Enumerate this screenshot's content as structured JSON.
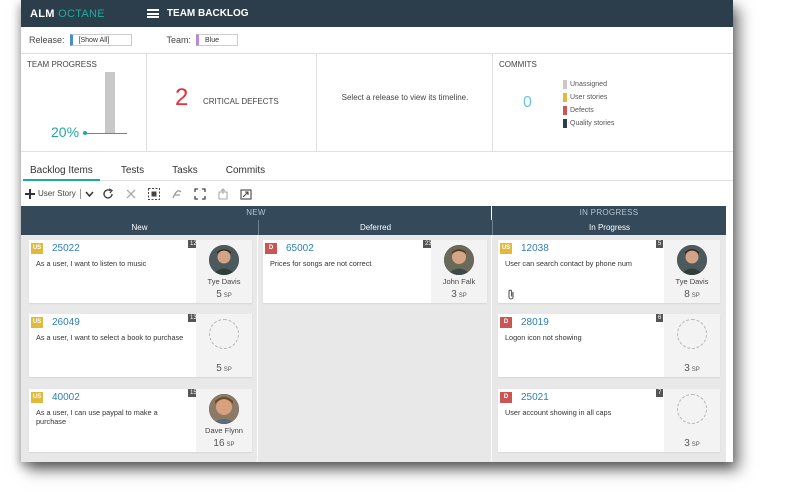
{
  "app": {
    "logo_bold": "ALM",
    "logo_light": "OCTANE",
    "page_title": "TEAM BACKLOG"
  },
  "filters": {
    "release_label": "Release:",
    "release_value": "[Show All]",
    "team_label": "Team:",
    "team_value": "Blue"
  },
  "widgets": {
    "progress": {
      "title": "TEAM PROGRESS",
      "percent_text": "20%",
      "percent_value": 0.2
    },
    "defects": {
      "count": "2",
      "label": "CRITICAL DEFECTS"
    },
    "timeline": {
      "message": "Select a release to view its timeline."
    },
    "commits": {
      "title": "COMMITS",
      "count": "0",
      "legend": [
        {
          "label": "Unassigned",
          "color": "#c8c8c8"
        },
        {
          "label": "User stories",
          "color": "#e0b93d"
        },
        {
          "label": "Defects",
          "color": "#c95653"
        },
        {
          "label": "Quality stories",
          "color": "#2c3e4c"
        }
      ]
    }
  },
  "tabs": [
    "Backlog Items",
    "Tests",
    "Tasks",
    "Commits"
  ],
  "toolbar": {
    "new_item_label": "User Story"
  },
  "board": {
    "groups": [
      "NEW",
      "IN PROGRESS"
    ],
    "columns": [
      "New",
      "Deferred",
      "In Progress"
    ],
    "cards": {
      "c1": {
        "type": "US",
        "id": "25022",
        "title": "As a user, I want to listen to music",
        "rank": "12",
        "owner": "Tye Davis",
        "sp": "5",
        "sp_unit": "SP"
      },
      "c2": {
        "type": "US",
        "id": "26049",
        "title": "As a user, I want to select a book to purchase",
        "rank": "13",
        "owner": "",
        "sp": "5",
        "sp_unit": "SP"
      },
      "c3": {
        "type": "US",
        "id": "40002",
        "title": "As a user, I can use paypal to make a purchase",
        "rank": "15",
        "owner": "Dave Flynn",
        "sp": "16",
        "sp_unit": "SP"
      },
      "c4": {
        "type": "D",
        "id": "65002",
        "title": "Prices for songs are not correct",
        "rank": "23",
        "owner": "John Falk",
        "sp": "3",
        "sp_unit": "SP"
      },
      "c5": {
        "type": "US",
        "id": "12038",
        "title": "User can search contact by phone num",
        "rank": "5",
        "owner": "Tye Davis",
        "sp": "8",
        "sp_unit": "SP"
      },
      "c6": {
        "type": "D",
        "id": "28019",
        "title": "Logon icon not showing",
        "rank": "6",
        "owner": "",
        "sp": "3",
        "sp_unit": "SP"
      },
      "c7": {
        "type": "D",
        "id": "25021",
        "title": "User account showing in all caps",
        "rank": "7",
        "owner": "",
        "sp": "3",
        "sp_unit": "SP"
      }
    }
  },
  "colors": {
    "header_bg": "#2c3e4c",
    "accent": "#1aac9c",
    "critical": "#e5323c",
    "link": "#2f7fb3"
  }
}
